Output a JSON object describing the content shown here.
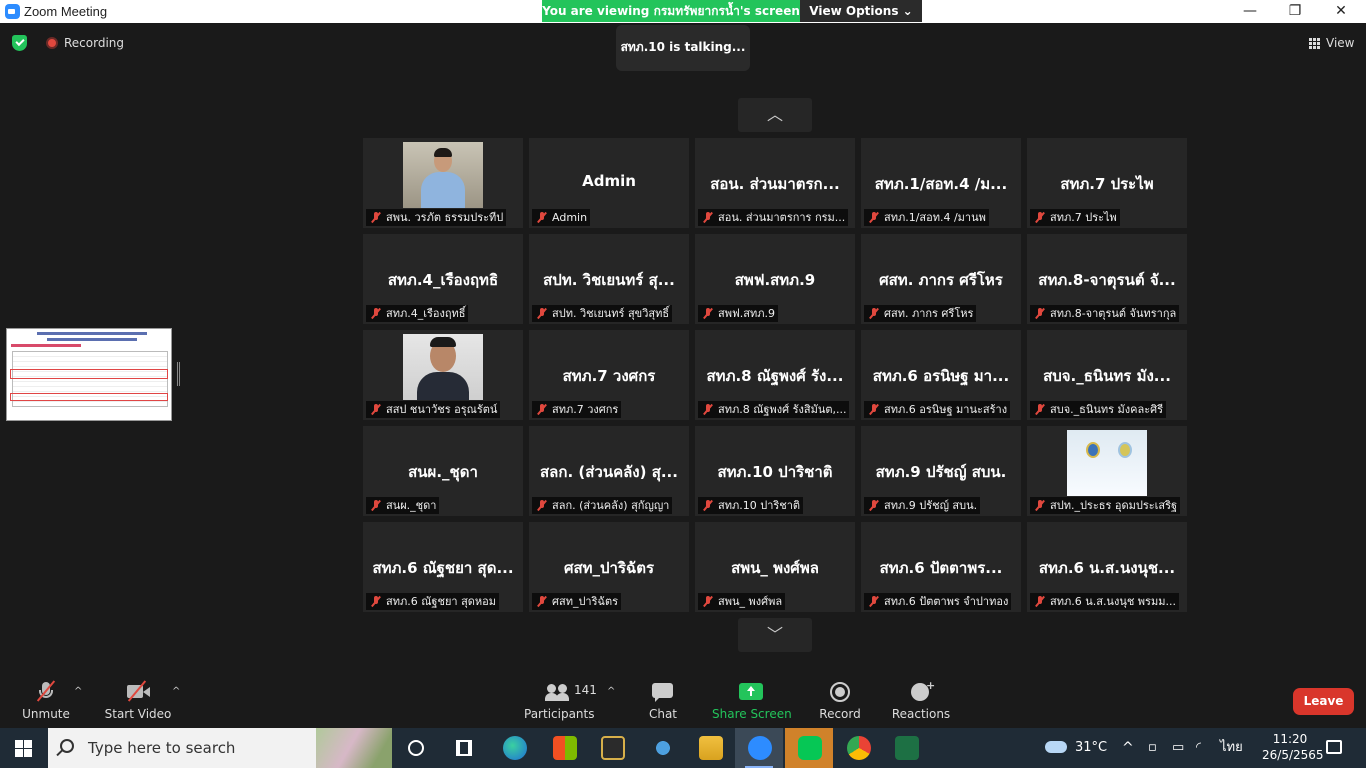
{
  "window": {
    "title": "Zoom Meeting",
    "minimize": "—",
    "maximize": "❐",
    "close": "✕"
  },
  "banner": {
    "viewing": "You are viewing กรมทรัพยากรน้ำ's screen",
    "view_options": "View Options ⌄"
  },
  "top": {
    "recording": "Recording",
    "talking": "สทภ.10 is  talking...",
    "view": "View"
  },
  "arrows": {
    "up": "︿",
    "down": "﹀"
  },
  "tiles": [
    {
      "name": "",
      "label": "สพน. วรภัต ธรรมประทีป",
      "type": "photo-a"
    },
    {
      "name": "Admin",
      "label": "Admin"
    },
    {
      "name": "สอน. ส่วนมาตรก...",
      "label": "สอน. ส่วนมาตรการ กรม..."
    },
    {
      "name": "สทภ.1/สอท.4 /ม...",
      "label": "สทภ.1/สอท.4 /มานพ"
    },
    {
      "name": "สทภ.7 ประไพ",
      "label": "สทภ.7 ประไพ"
    },
    {
      "name": "สทภ.4_เรืองฤทธิ",
      "label": "สทภ.4_เรืองฤทธิ์"
    },
    {
      "name": "สปท. วิชเยนทร์ สุ...",
      "label": "สปท. วิชเยนทร์ สุขวิสุทธิ์"
    },
    {
      "name": "สพฟ.สทภ.9",
      "label": "สพฟ.สทภ.9"
    },
    {
      "name": "ศสท. ภากร ศรีโหร",
      "label": "ศสท. ภากร ศรีโหร"
    },
    {
      "name": "สทภ.8-จาตุรนต์ จั...",
      "label": "สทภ.8-จาตุรนต์ จันทรากุล"
    },
    {
      "name": "",
      "label": "สสป ชนาวัชร อรุณรัตน์",
      "type": "photo-b"
    },
    {
      "name": "สทภ.7 วงศกร",
      "label": "สทภ.7 วงศกร"
    },
    {
      "name": "สทภ.8 ณัฐพงศ์ รัง...",
      "label": "สทภ.8 ณัฐพงศ์ รังสิมันต,..."
    },
    {
      "name": "สทภ.6 อรนิษฐ มา...",
      "label": "สทภ.6 อรนิษฐ มานะสร้าง"
    },
    {
      "name": "สบจ._ธนินทร มัง...",
      "label": "สบจ._ธนินทร มังคละศิรี"
    },
    {
      "name": "สนผ._ชุดา",
      "label": "สนผ._ชุดา"
    },
    {
      "name": "สลก. (ส่วนคลัง) สุ...",
      "label": "สลก. (ส่วนคลัง) สุกัญญา"
    },
    {
      "name": "สทภ.10 ปาริชาติ",
      "label": "สทภ.10 ปาริชาติ"
    },
    {
      "name": "สทภ.9 ปรัชญ์ สบน.",
      "label": "สทภ.9 ปรัชญ์ สบน."
    },
    {
      "name": "",
      "label": "สปท._ประธร อุดมประเสริฐ",
      "type": "logo"
    },
    {
      "name": "สทภ.6 ณัฐชยา สุด...",
      "label": "สทภ.6 ณัฐชยา สุดหอม"
    },
    {
      "name": "ศสท_ปาริฉัตร",
      "label": "ศสท_ปาริฉัตร"
    },
    {
      "name": "สพน_ พงศ์พล",
      "label": "สพน_ พงศ์พล"
    },
    {
      "name": "สทภ.6 ปัตตาพร...",
      "label": "สทภ.6 ปัตตาพร  จำปาทอง"
    },
    {
      "name": "สทภ.6  น.ส.นงนุช...",
      "label": "สทภ.6  น.ส.นงนุช พรมม..."
    }
  ],
  "toolbar": {
    "unmute": "Unmute",
    "start_video": "Start Video",
    "participants": "Participants",
    "participant_count": "141",
    "chat": "Chat",
    "share_screen": "Share Screen",
    "record": "Record",
    "reactions": "Reactions",
    "leave": "Leave",
    "caret": "^"
  },
  "taskbar": {
    "search_placeholder": "Type here to search",
    "temperature": "31°C",
    "language": "ไทย",
    "time": "11:20",
    "date": "26/5/2565"
  },
  "colors": {
    "accent_green": "#23c45b",
    "leave_red": "#d9362b",
    "muted_red": "#e0483e"
  }
}
